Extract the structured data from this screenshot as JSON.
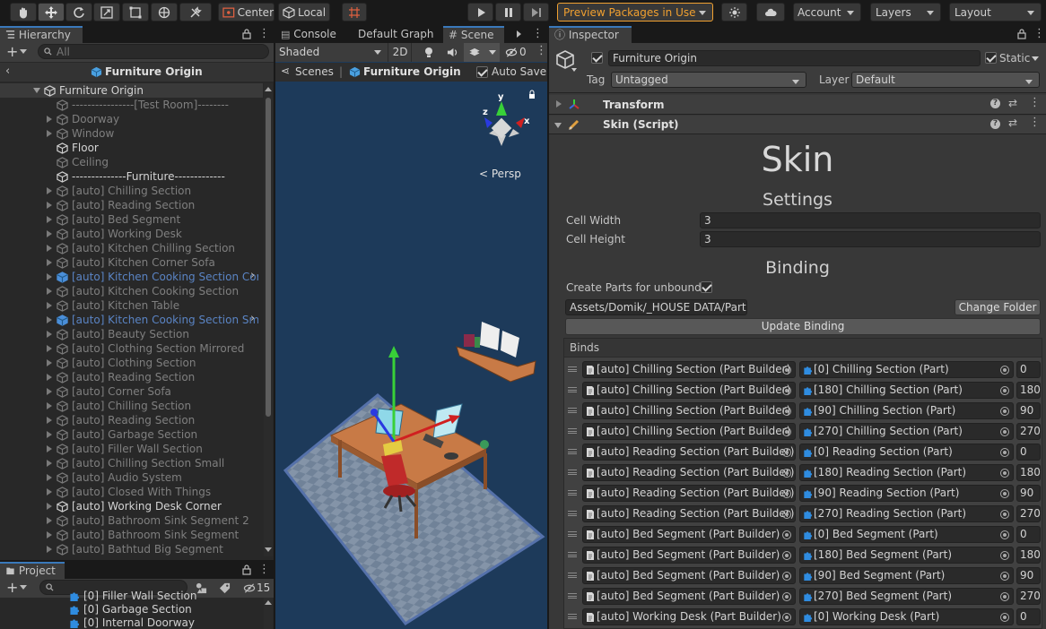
{
  "toolbar": {
    "pivot_label": "Center",
    "space_label": "Local",
    "preview_packages_label": "Preview Packages in Use",
    "account_label": "Account",
    "layers_label": "Layers",
    "layout_label": "Layout",
    "accent_color": "#f0a030"
  },
  "hierarchy": {
    "tab_label": "Hierarchy",
    "search_placeholder": "All",
    "breadcrumb_title": "Furniture Origin",
    "root_label": "Furniture Origin",
    "items": [
      {
        "label": "----------------[Test Room]--------",
        "style": "grey",
        "arrow": false
      },
      {
        "label": "Doorway",
        "style": "grey",
        "arrow": true
      },
      {
        "label": "Window",
        "style": "grey",
        "arrow": true
      },
      {
        "label": "Floor",
        "style": "white",
        "arrow": false
      },
      {
        "label": "Ceiling",
        "style": "grey",
        "arrow": false
      },
      {
        "label": "--------------Furniture-------------",
        "style": "white",
        "arrow": false
      },
      {
        "label": "[auto] Chilling Section",
        "style": "grey",
        "arrow": true
      },
      {
        "label": "[auto] Reading Section",
        "style": "grey",
        "arrow": true
      },
      {
        "label": "[auto] Bed Segment",
        "style": "grey",
        "arrow": true
      },
      {
        "label": "[auto] Working Desk",
        "style": "grey",
        "arrow": true
      },
      {
        "label": "[auto] Kitchen Chilling Section",
        "style": "grey",
        "arrow": true
      },
      {
        "label": "[auto] Kitchen Corner Sofa",
        "style": "grey",
        "arrow": true
      },
      {
        "label": "[auto] Kitchen Cooking Section Cor",
        "style": "blue",
        "arrow": true,
        "chevron": true
      },
      {
        "label": "[auto] Kitchen Cooking Section",
        "style": "grey",
        "arrow": true
      },
      {
        "label": "[auto] Kitchen Table",
        "style": "grey",
        "arrow": true
      },
      {
        "label": "[auto] Kitchen Cooking Section Sm",
        "style": "blue",
        "arrow": true,
        "chevron": true
      },
      {
        "label": "[auto] Beauty Section",
        "style": "grey",
        "arrow": true
      },
      {
        "label": "[auto] Clothing Section Mirrored",
        "style": "grey",
        "arrow": true
      },
      {
        "label": "[auto] Clothing Section",
        "style": "grey",
        "arrow": true
      },
      {
        "label": "[auto] Reading Section",
        "style": "grey",
        "arrow": true
      },
      {
        "label": "[auto] Corner Sofa",
        "style": "grey",
        "arrow": true
      },
      {
        "label": "[auto] Chilling Section",
        "style": "grey",
        "arrow": true
      },
      {
        "label": "[auto] Reading Section",
        "style": "grey",
        "arrow": true
      },
      {
        "label": "[auto] Garbage Section",
        "style": "grey",
        "arrow": true
      },
      {
        "label": "[auto] Filler Wall Section",
        "style": "grey",
        "arrow": true
      },
      {
        "label": "[auto] Chilling Section Small",
        "style": "grey",
        "arrow": true
      },
      {
        "label": "[auto] Audio System",
        "style": "grey",
        "arrow": true
      },
      {
        "label": "[auto] Closed With Things",
        "style": "grey",
        "arrow": true
      },
      {
        "label": "[auto] Working Desk Corner",
        "style": "white",
        "arrow": true
      },
      {
        "label": "[auto] Bathroom Sink Segment 2",
        "style": "grey",
        "arrow": true
      },
      {
        "label": "[auto] Bathroom Sink Segment",
        "style": "grey",
        "arrow": true
      },
      {
        "label": "[auto] Bathtud Big Segment",
        "style": "grey",
        "arrow": true
      }
    ]
  },
  "project": {
    "tab_label": "Project",
    "hidden_count": "15",
    "items": [
      "[0] Filler Wall Section",
      "[0] Garbage Section",
      "[0] Internal Doorway"
    ]
  },
  "scene": {
    "tabs": [
      "Console",
      "Default Graph",
      "Scene"
    ],
    "shading_mode": "Shaded",
    "mode_2d": "2D",
    "hidden_count": "0",
    "breadcrumb_root": "Scenes",
    "breadcrumb_prefab": "Furniture Origin",
    "auto_save_label": "Auto Save",
    "persp_label": "Persp",
    "gizmo_axes": [
      "y",
      "z",
      "x"
    ]
  },
  "inspector": {
    "tab_label": "Inspector",
    "object_name": "Furniture Origin",
    "static_label": "Static",
    "tag_label": "Tag",
    "tag_value": "Untagged",
    "layer_label": "Layer",
    "layer_value": "Default",
    "components": [
      "Transform",
      "Skin (Script)"
    ],
    "skin_title": "Skin",
    "settings_header": "Settings",
    "cell_width_label": "Cell Width",
    "cell_width_value": "3",
    "cell_height_label": "Cell Height",
    "cell_height_value": "3",
    "binding_header": "Binding",
    "create_parts_label": "Create Parts for unbound?",
    "folder_path": "Assets/Domik/_HOUSE DATA/Parts",
    "change_folder_label": "Change Folder",
    "update_binding_label": "Update Binding",
    "binds_label": "Binds",
    "binds": [
      {
        "builder": "[auto] Chilling Section (Part Builder)",
        "part": "[0] Chilling Section (Part)",
        "rotation": "0"
      },
      {
        "builder": "[auto] Chilling Section (Part Builder)",
        "part": "[180] Chilling Section (Part)",
        "rotation": "180"
      },
      {
        "builder": "[auto] Chilling Section (Part Builder)",
        "part": "[90] Chilling Section (Part)",
        "rotation": "90"
      },
      {
        "builder": "[auto] Chilling Section (Part Builder)",
        "part": "[270] Chilling Section (Part)",
        "rotation": "270"
      },
      {
        "builder": "[auto] Reading Section (Part Builder)",
        "part": "[0] Reading Section (Part)",
        "rotation": "0"
      },
      {
        "builder": "[auto] Reading Section (Part Builder)",
        "part": "[180] Reading Section (Part)",
        "rotation": "180"
      },
      {
        "builder": "[auto] Reading Section (Part Builder)",
        "part": "[90] Reading Section (Part)",
        "rotation": "90"
      },
      {
        "builder": "[auto] Reading Section (Part Builder)",
        "part": "[270] Reading Section (Part)",
        "rotation": "270"
      },
      {
        "builder": "[auto] Bed Segment (Part Builder)",
        "part": "[0] Bed Segment (Part)",
        "rotation": "0"
      },
      {
        "builder": "[auto] Bed Segment (Part Builder)",
        "part": "[180] Bed Segment (Part)",
        "rotation": "180"
      },
      {
        "builder": "[auto] Bed Segment (Part Builder)",
        "part": "[90] Bed Segment (Part)",
        "rotation": "90"
      },
      {
        "builder": "[auto] Bed Segment (Part Builder)",
        "part": "[270] Bed Segment (Part)",
        "rotation": "270"
      },
      {
        "builder": "[auto] Working Desk (Part Builder)",
        "part": "[0] Working Desk (Part)",
        "rotation": "0"
      }
    ]
  }
}
